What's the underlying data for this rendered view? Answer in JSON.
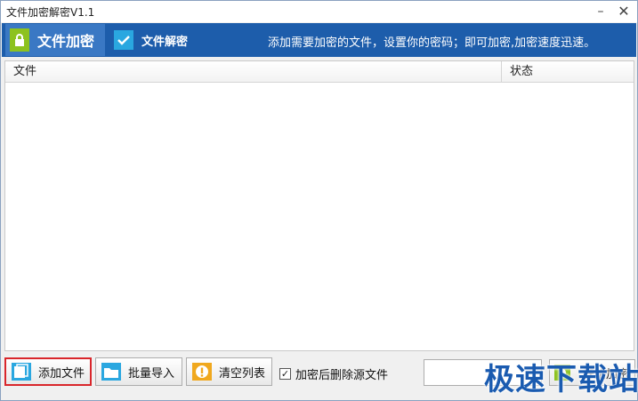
{
  "window": {
    "title": "文件加密解密V1.1",
    "minimize_glyph": "–",
    "close_glyph": "✕"
  },
  "tabs": {
    "encrypt": {
      "label": "文件加密",
      "icon": "lock-icon"
    },
    "decrypt": {
      "label": "文件解密",
      "icon": "check-icon"
    },
    "hint": "添加需要加密的文件，设置你的密码；即可加密,加密速度迅速。"
  },
  "file_list": {
    "columns": [
      "文件",
      "状态"
    ],
    "rows": []
  },
  "toolbar": {
    "add_file_label": "添加文件",
    "batch_import_label": "批量导入",
    "clear_list_label": "清空列表",
    "delete_source_label": "加密后删除源文件",
    "delete_source_checked": true,
    "password_value": "",
    "start_label": "开始加密"
  },
  "watermark": {
    "text": "极速下载站"
  },
  "colors": {
    "header_blue": "#1d5dab",
    "active_tab": "#3a78c4",
    "lock_green": "#8dc21f",
    "check_cyan": "#2aa7e0",
    "highlight_red": "#d9262b"
  }
}
